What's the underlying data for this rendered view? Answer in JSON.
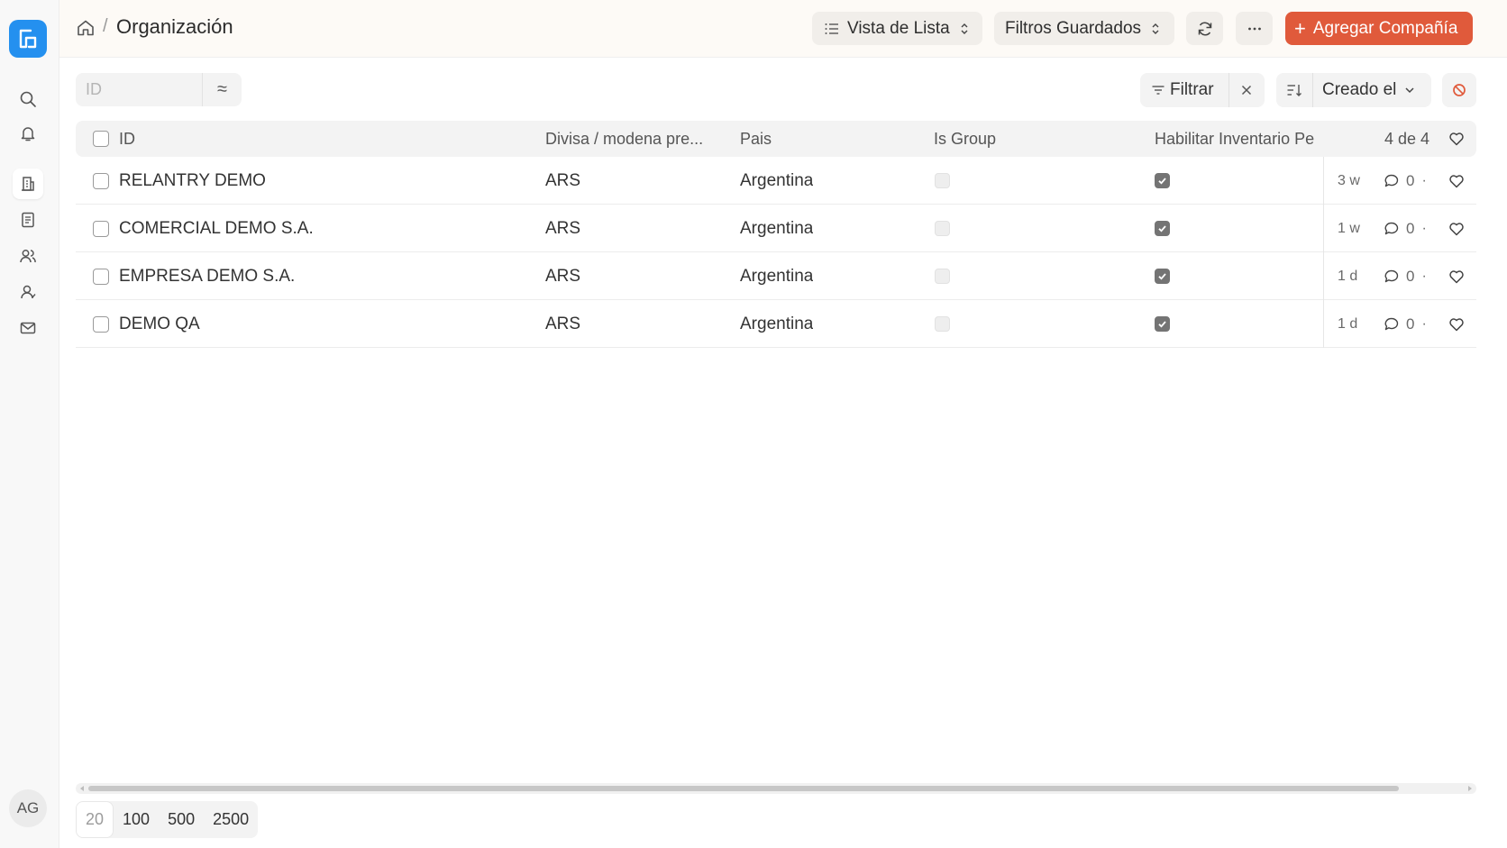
{
  "sidebar": {
    "logo_icon": "frappe-logo-icon",
    "icons": [
      "search-icon",
      "bell-icon",
      "building-icon",
      "document-icon",
      "users-icon",
      "user-icon",
      "mail-icon"
    ],
    "avatar_initials": "AG"
  },
  "header": {
    "breadcrumb_separator": "/",
    "title": "Organización",
    "view_button": "Vista de Lista",
    "saved_filters_button": "Filtros Guardados",
    "add_button": "Agregar Compañía",
    "add_button_prefix": "+"
  },
  "toolbar": {
    "search_placeholder": "ID",
    "approx_symbol": "≈",
    "filter_label": "Filtrar",
    "sort_label": "Creado el"
  },
  "table": {
    "headers": {
      "id": "ID",
      "currency": "Divisa / modena pre...",
      "country": "Pais",
      "is_group": "Is Group",
      "inventory": "Habilitar Inventario Pe",
      "count": "4 de 4"
    },
    "rows": [
      {
        "id": "RELANTRY DEMO",
        "currency": "ARS",
        "country": "Argentina",
        "is_group": false,
        "inventory": true,
        "age": "3 w",
        "comments": "0"
      },
      {
        "id": "COMERCIAL DEMO S.A.",
        "currency": "ARS",
        "country": "Argentina",
        "is_group": false,
        "inventory": true,
        "age": "1 w",
        "comments": "0"
      },
      {
        "id": "EMPRESA DEMO S.A.",
        "currency": "ARS",
        "country": "Argentina",
        "is_group": false,
        "inventory": true,
        "age": "1 d",
        "comments": "0"
      },
      {
        "id": "DEMO QA",
        "currency": "ARS",
        "country": "Argentina",
        "is_group": false,
        "inventory": true,
        "age": "1 d",
        "comments": "0"
      }
    ]
  },
  "pager": {
    "sizes": [
      "20",
      "100",
      "500",
      "2500"
    ],
    "selected": "20"
  },
  "colors": {
    "brand": "#2490ef",
    "primary_button": "#e05a3b",
    "header_bg": "#fdfaf6"
  }
}
